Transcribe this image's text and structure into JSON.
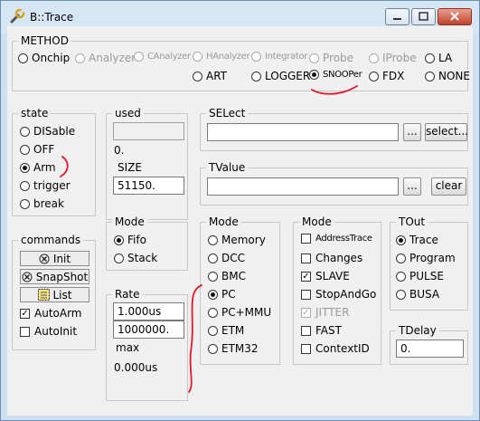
{
  "window": {
    "title": "B::Trace"
  },
  "method": {
    "title": "METHOD",
    "options": [
      "Onchip",
      "Analyzer",
      "CAnalyzer",
      "HAnalyzer",
      "Integrator",
      "Probe",
      "IProbe",
      "LA",
      "ART",
      "LOGGER",
      "SNOOPer",
      "FDX",
      "NONE"
    ],
    "selected": "SNOOPer"
  },
  "state": {
    "title": "state",
    "options": [
      "DISable",
      "OFF",
      "Arm",
      "trigger",
      "break"
    ],
    "selected": "Arm"
  },
  "commands": {
    "title": "commands",
    "init_label": "Init",
    "snapshot_label": "SnapShot",
    "list_label": "List",
    "autoarm_label": "AutoArm",
    "autoarm_checked": true,
    "autoinit_label": "AutoInit",
    "autoinit_checked": false
  },
  "used": {
    "title": "used",
    "value": "",
    "readout": "0."
  },
  "size": {
    "title": "SIZE",
    "value": "51150."
  },
  "select": {
    "title": "SELect",
    "value": "",
    "browse_label": "...",
    "button_label": "select..."
  },
  "tvalue": {
    "title": "TValue",
    "value": "",
    "browse_label": "...",
    "button_label": "clear"
  },
  "mode1": {
    "title": "Mode",
    "options": [
      "Fifo",
      "Stack"
    ],
    "selected": "Fifo"
  },
  "rate": {
    "title": "Rate",
    "value1": "1.000us",
    "value2": "1000000.",
    "max_label": "max",
    "max_value": "0.000us"
  },
  "mode2": {
    "title": "Mode",
    "options": [
      "Memory",
      "DCC",
      "BMC",
      "PC",
      "PC+MMU",
      "ETM",
      "ETM32"
    ],
    "selected": "PC"
  },
  "mode3": {
    "title": "Mode",
    "items": [
      {
        "label": "AddressTrace",
        "checked": false,
        "disabled": false,
        "small": true
      },
      {
        "label": "Changes",
        "checked": false,
        "disabled": false,
        "small": false
      },
      {
        "label": "SLAVE",
        "checked": true,
        "disabled": false,
        "small": false
      },
      {
        "label": "StopAndGo",
        "checked": false,
        "disabled": false,
        "small": false
      },
      {
        "label": "JITTER",
        "checked": true,
        "disabled": true,
        "small": false
      },
      {
        "label": "FAST",
        "checked": false,
        "disabled": false,
        "small": false
      },
      {
        "label": "ContextID",
        "checked": false,
        "disabled": false,
        "small": false
      }
    ]
  },
  "tout": {
    "title": "TOut",
    "options": [
      "Trace",
      "Program",
      "PULSE",
      "BUSA"
    ],
    "selected": "Trace"
  },
  "tdelay": {
    "title": "TDelay",
    "value": "0."
  },
  "colors": {
    "annotation": "#e0182a",
    "titlebar": "#d7e6f4",
    "background": "#f0f0f0"
  }
}
